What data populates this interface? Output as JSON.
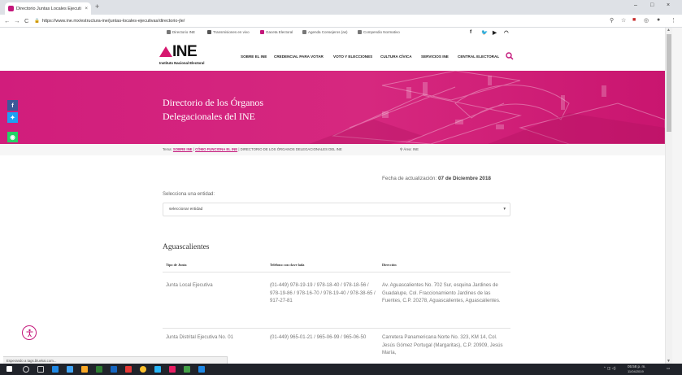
{
  "browser": {
    "tab_title": "Directorio Juntas Locales Ejecuti",
    "tab_close": "×",
    "new_tab": "+",
    "window_controls": [
      "–",
      "□",
      "×"
    ],
    "nav_buttons": [
      "←",
      "→",
      "C"
    ],
    "url": "https://www.ine.mx/estructura-ine/juntas-locales-ejecutivas/directorio-jle/",
    "right_icons": [
      "search-icon",
      "star-icon",
      "extension-icon",
      "extension-icon",
      "profile-icon",
      "menu-icon"
    ]
  },
  "topbar": {
    "items": [
      {
        "label": "Directorio INE",
        "icon": "building-icon",
        "color": "#777777"
      },
      {
        "label": "Transmisiones en vivo",
        "icon": "video-icon",
        "color": "#555555"
      },
      {
        "label": "Gaceta Electoral",
        "icon": "newspaper-icon",
        "color": "#c4177b"
      },
      {
        "label": "Agenda Consejeros (as)",
        "icon": "calendar-icon",
        "color": "#777777"
      },
      {
        "label": "Compendio Normativo",
        "icon": "book-icon",
        "color": "#777777"
      }
    ],
    "social": [
      "f",
      "t",
      "▶",
      "rss"
    ]
  },
  "brand": {
    "logo_text": "INE",
    "logo_sub": "Instituto Nacional Electoral",
    "accent": "#d11d7c",
    "hero_color": "#d11d7c"
  },
  "nav": [
    "SOBRE EL INE",
    "CREDENCIAL PARA VOTAR",
    "VOTO Y ELECCIONES",
    "CULTURA CÍVICA",
    "SERVICIOS INE",
    "CENTRAL ELECTORAL"
  ],
  "hero": {
    "title_line1": "Directorio de los Órganos",
    "title_line2": "Delegacionales del INE"
  },
  "social_float": [
    "f",
    "t",
    "w",
    "✉"
  ],
  "breadcrumb": {
    "prefix": "Tema:",
    "items": [
      "SOBRE INE",
      "CÓMO FUNCIONA EL INE"
    ],
    "separator": "|",
    "current": "DIRECTORIO DE LOS ÓRGANOS DELEGACIONALES DEL INE",
    "area": "Área: INE"
  },
  "content": {
    "updated_label": "Fecha de actualización:",
    "updated_date": "07 de Diciembre 2018",
    "select_label": "Selecciona una entidad:",
    "select_value": "seleccionar entidad",
    "state": "Aguascalientes",
    "columns": [
      "Tipo de Junta",
      "Teléfono con clave lada",
      "Dirección"
    ],
    "rows": [
      {
        "tipo": "Junta Local Ejecutiva",
        "telefono": "(01-449) 978-19-19 / 978-18-40 / 978-18-56 / 978-19-86 / 978-16-70 / 978-19-40 / 978-38-65 / 917-27-81",
        "direccion": "Av. Aguascalientes No. 702 Sur, esquina Jardines de Guadalupe, Col. Fraccionamiento Jardines de las Fuentes, C.P. 20278, Aguascalientes, Aguascalientes."
      },
      {
        "tipo": "Junta Distrital Ejecutiva No. 01",
        "telefono": "(01-449) 965-01-21 / 965-06-99 / 965-06-50",
        "direccion": "Carretera Panamericana Norte No. 323, KM 14, Col. Jesús Gómez Portugal (Margaritas), C.P. 20909, Jesús María,"
      }
    ]
  },
  "status": {
    "text": "Esperando a tags.bluekai.com..."
  },
  "taskbar": {
    "time": "05:58 p. m.",
    "date": "11/04/2019"
  }
}
